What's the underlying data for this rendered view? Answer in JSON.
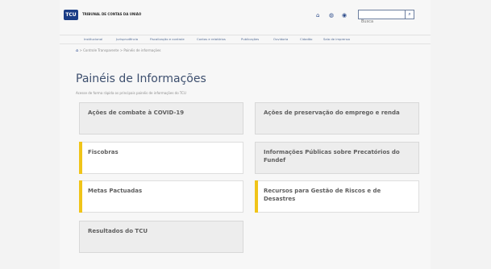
{
  "header": {
    "logo_text": "TCU",
    "org_name": "TRIBUNAL DE CONTAS DA UNIÃO",
    "search_placeholder": "Busca",
    "icons": [
      "home-icon",
      "map-icon",
      "accessibility-icon",
      "search-icon"
    ],
    "search_button": "⌕"
  },
  "nav": {
    "items": [
      "Institucional",
      "Jurisprudência",
      "Fiscalização e controle",
      "Contas e relatórios",
      "Publicações",
      "Ouvidoria",
      "Cidadão",
      "Sala de imprensa"
    ]
  },
  "breadcrumb": {
    "home_icon": "⌂",
    "separator": ">",
    "items": [
      "Controle Transparente",
      "Painéis de informações"
    ]
  },
  "page": {
    "title": "Painéis de Informações",
    "subtitle": "Acesse de forma rápida os principais painéis de informações do TCU"
  },
  "cards": [
    {
      "label": "Ações de combate à COVID-19",
      "highlight": false
    },
    {
      "label": "Ações de preservação do emprego e renda",
      "highlight": false
    },
    {
      "label": "Fiscobras",
      "highlight": true
    },
    {
      "label": "Informações Públicas sobre Precatórios do Fundef",
      "highlight": false
    },
    {
      "label": "Metas Pactuadas",
      "highlight": true
    },
    {
      "label": "Recursos para Gestão de Riscos e de Desastres",
      "highlight": true
    },
    {
      "label": "Resultados do TCU",
      "highlight": false
    }
  ],
  "colors": {
    "brand": "#1b3d86",
    "accent": "#f0c419",
    "title": "#3d4f6e"
  }
}
